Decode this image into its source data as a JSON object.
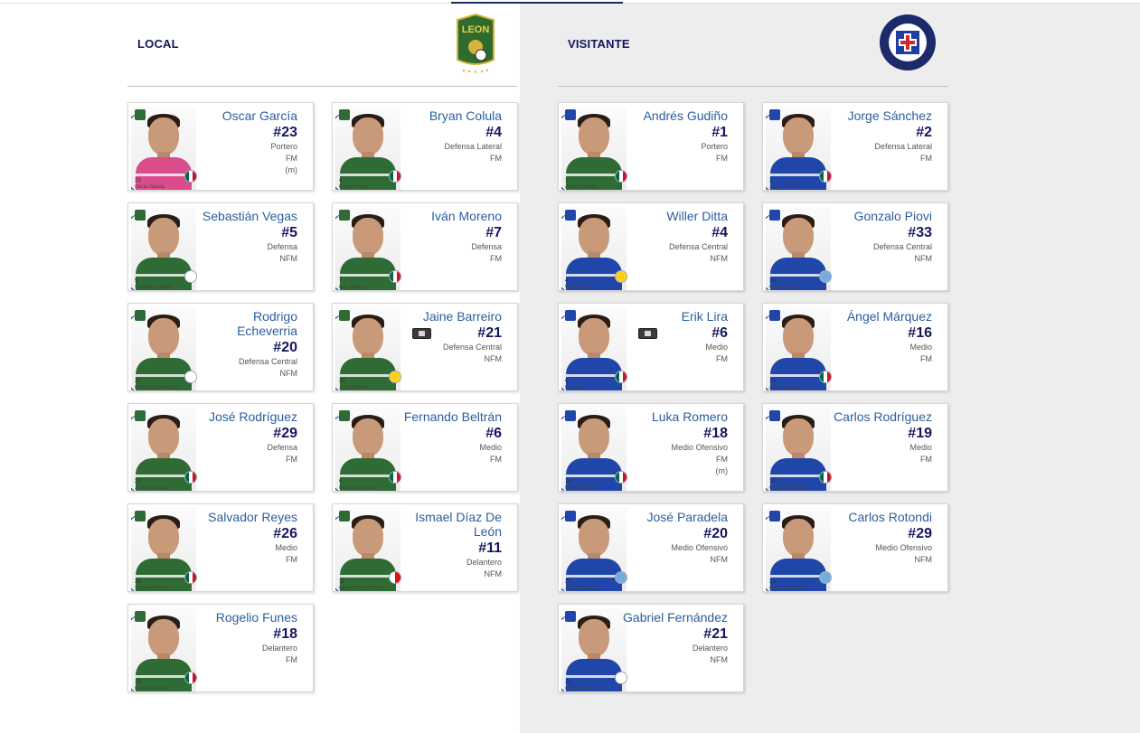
{
  "colors": {
    "title": "#16165e",
    "player_name": "#2b5e9e",
    "leon_green": "#2f6b34",
    "cruz_blue": "#1f46a8"
  },
  "teams": {
    "local": {
      "title": "LOCAL",
      "logo_icon": "club-leon-crest",
      "players": [
        {
          "name": "Oscar García",
          "number": "#23",
          "position": "Portero",
          "status": "FM",
          "note": "(m)",
          "photo_number": "23",
          "photo_name": "Oscar García",
          "flag": "mexico",
          "shirt": "#d94d8c"
        },
        {
          "name": "Bryan Colula",
          "number": "#4",
          "position": "Defensa Lateral",
          "status": "FM",
          "note": "",
          "photo_number": "4",
          "photo_name": "Bryan Colula",
          "flag": "mexico",
          "shirt": "#2f6b34"
        },
        {
          "name": "Sebastián Vegas",
          "number": "#5",
          "position": "Defensa",
          "status": "NFM",
          "note": "",
          "photo_number": "5",
          "photo_name": "Sebastián Vegas",
          "flag": "chile",
          "shirt": "#2f6b34"
        },
        {
          "name": "Iván Moreno",
          "number": "#7",
          "position": "Defensa",
          "status": "FM",
          "note": "",
          "photo_number": "7",
          "photo_name": "Iván Moreno",
          "flag": "mexico",
          "shirt": "#2f6b34"
        },
        {
          "name": "Rodrigo Echeverria",
          "number": "#20",
          "position": "Defensa Central",
          "status": "NFM",
          "note": "",
          "photo_number": "20",
          "photo_name": "Rodrigo Echeverría",
          "flag": "chile",
          "shirt": "#2f6b34"
        },
        {
          "name": "Jaine Barreiro",
          "number": "#21",
          "position": "Defensa Central",
          "status": "NFM",
          "note": "",
          "photo_number": "21",
          "photo_name": "Jaine Barreiro",
          "flag": "colombia",
          "shirt": "#2f6b34",
          "captain": true
        },
        {
          "name": "José Rodríguez",
          "number": "#29",
          "position": "Defensa",
          "status": "FM",
          "note": "",
          "photo_number": "29",
          "photo_name": "José Rodríguez",
          "flag": "mexico",
          "shirt": "#2f6b34"
        },
        {
          "name": "Fernando Beltrán",
          "number": "#6",
          "position": "Medio",
          "status": "FM",
          "note": "",
          "photo_number": "6",
          "photo_name": "Fernando Beltrán",
          "flag": "mexico",
          "shirt": "#2f6b34"
        },
        {
          "name": "Salvador Reyes",
          "number": "#26",
          "position": "Medio",
          "status": "FM",
          "note": "",
          "photo_number": "26",
          "photo_name": "Salvador Reyes",
          "flag": "mexico",
          "shirt": "#2f6b34"
        },
        {
          "name": "Ismael Díaz De León",
          "number": "#11",
          "position": "Delantero",
          "status": "NFM",
          "note": "",
          "photo_number": "11",
          "photo_name": "Ismael Díaz De León",
          "flag": "panama",
          "shirt": "#2f6b34"
        },
        {
          "name": "Rogelio Funes",
          "number": "#18",
          "position": "Delantero",
          "status": "FM",
          "note": "",
          "photo_number": "18",
          "photo_name": "Rogelio Funes",
          "flag": "mexico",
          "shirt": "#2f6b34"
        }
      ]
    },
    "visit": {
      "title": "VISITANTE",
      "logo_icon": "cruz-azul-crest",
      "players": [
        {
          "name": "Andrés Gudiño",
          "number": "#1",
          "position": "Portero",
          "status": "FM",
          "note": "",
          "photo_number": "1",
          "photo_name": "Andrés Gudiño",
          "flag": "mexico",
          "shirt": "#2f6b34"
        },
        {
          "name": "Jorge Sánchez",
          "number": "#2",
          "position": "Defensa Lateral",
          "status": "FM",
          "note": "",
          "photo_number": "2",
          "photo_name": "Jorge Sánchez",
          "flag": "mexico",
          "shirt": "#1f46a8"
        },
        {
          "name": "Willer Ditta",
          "number": "#4",
          "position": "Defensa Central",
          "status": "NFM",
          "note": "",
          "photo_number": "4",
          "photo_name": "Willer Ditta",
          "flag": "colombia",
          "shirt": "#1f46a8"
        },
        {
          "name": "Gonzalo Piovi",
          "number": "#33",
          "position": "Defensa Central",
          "status": "NFM",
          "note": "",
          "photo_number": "33",
          "photo_name": "Gonzalo Piovi",
          "flag": "argentina",
          "shirt": "#1f46a8"
        },
        {
          "name": "Erik Lira",
          "number": "#6",
          "position": "Medio",
          "status": "FM",
          "note": "",
          "photo_number": "6",
          "photo_name": "Erik Lira",
          "flag": "mexico",
          "shirt": "#1f46a8",
          "captain": true
        },
        {
          "name": "Ángel Márquez",
          "number": "#16",
          "position": "Medio",
          "status": "FM",
          "note": "",
          "photo_number": "16",
          "photo_name": "Ángel Márquez",
          "flag": "mexico",
          "shirt": "#1f46a8"
        },
        {
          "name": "Luka Romero",
          "number": "#18",
          "position": "Medio Ofensivo",
          "status": "FM",
          "note": "(m)",
          "photo_number": "18",
          "photo_name": "Luka Romero",
          "flag": "mexico",
          "shirt": "#1f46a8"
        },
        {
          "name": "Carlos Rodríguez",
          "number": "#19",
          "position": "Medio",
          "status": "FM",
          "note": "",
          "photo_number": "19",
          "photo_name": "Carlos Rodríguez",
          "flag": "mexico",
          "shirt": "#1f46a8"
        },
        {
          "name": "José Paradela",
          "number": "#20",
          "position": "Medio Ofensivo",
          "status": "NFM",
          "note": "",
          "photo_number": "20",
          "photo_name": "José Paradela",
          "flag": "argentina",
          "shirt": "#1f46a8"
        },
        {
          "name": "Carlos Rotondi",
          "number": "#29",
          "position": "Medio Ofensivo",
          "status": "NFM",
          "note": "",
          "photo_number": "29",
          "photo_name": "Carlos Rotondi",
          "flag": "argentina",
          "shirt": "#1f46a8"
        },
        {
          "name": "Gabriel Fernández",
          "number": "#21",
          "position": "Delantero",
          "status": "NFM",
          "note": "",
          "photo_number": "21",
          "photo_name": "Gabriel Fernández",
          "flag": "uruguay",
          "shirt": "#1f46a8"
        }
      ]
    }
  }
}
